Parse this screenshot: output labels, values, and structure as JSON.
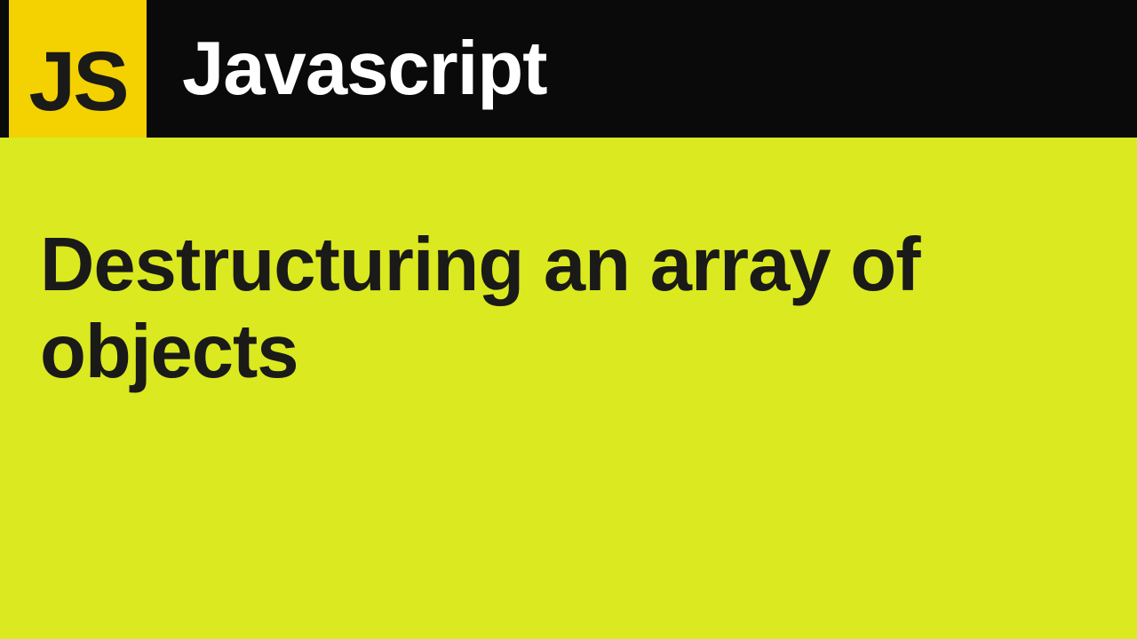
{
  "logo": {
    "text": "JS"
  },
  "header": {
    "title": "Javascript"
  },
  "main": {
    "title": "Destructuring an array of objects"
  },
  "colors": {
    "logo_bg": "#f4d100",
    "header_bg": "#0a0a0a",
    "body_bg": "#dbe920",
    "text_dark": "#1a1a18",
    "text_light": "#ffffff"
  }
}
